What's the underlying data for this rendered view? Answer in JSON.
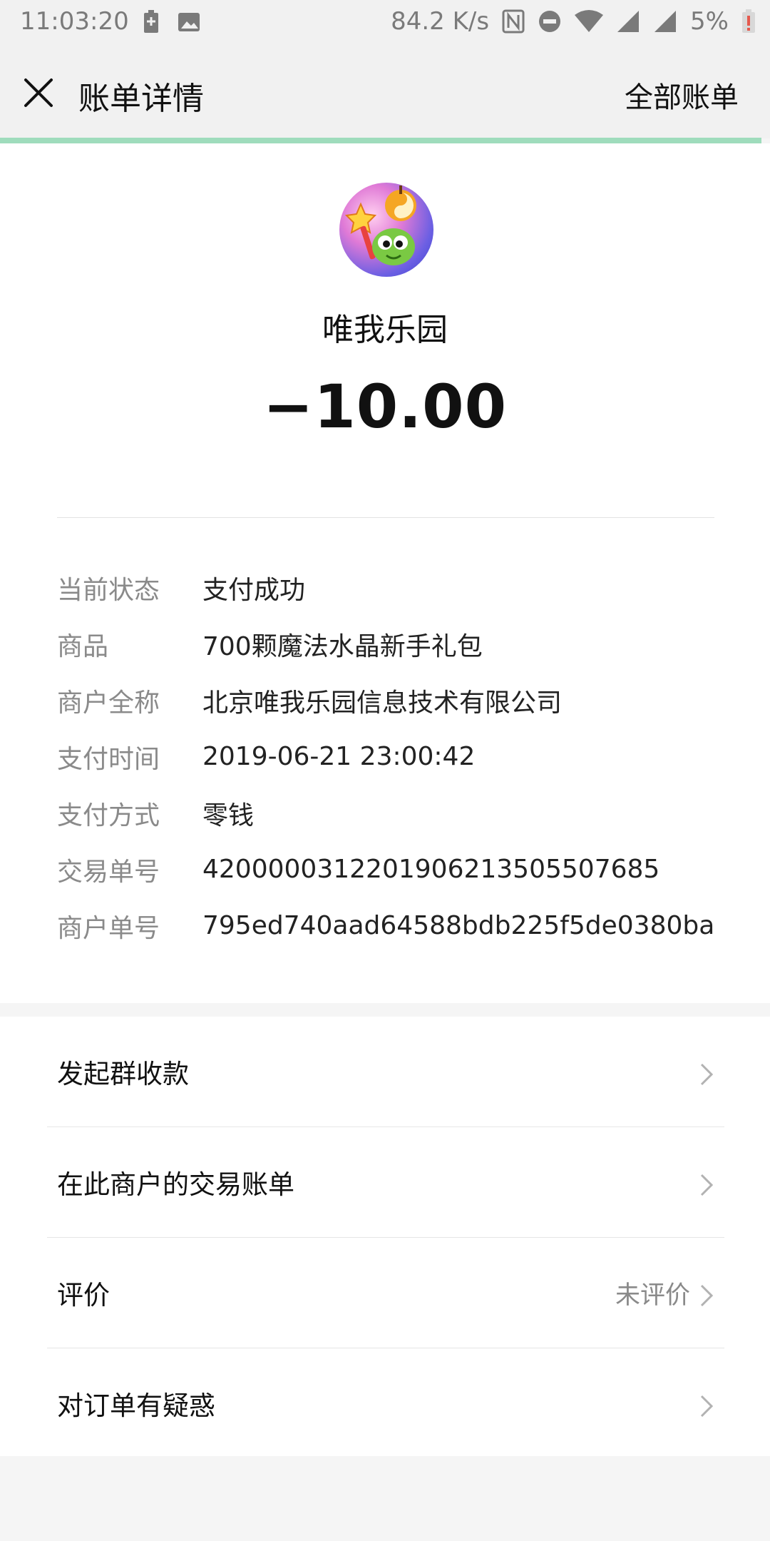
{
  "status_bar": {
    "time": "11:03:20",
    "net_speed": "84.2 K/s",
    "battery": "5%",
    "icons": [
      "battery-saver-icon",
      "image-icon",
      "nfc-icon",
      "dnd-icon",
      "wifi-icon",
      "signal-icon",
      "signal-icon",
      "battery-low-icon"
    ]
  },
  "header": {
    "title": "账单详情",
    "right_link": "全部账单"
  },
  "summary": {
    "merchant_name": "唯我乐园",
    "amount": "−10.00"
  },
  "details": [
    {
      "label": "当前状态",
      "value": "支付成功"
    },
    {
      "label": "商品",
      "value": "700颗魔法水晶新手礼包"
    },
    {
      "label": "商户全称",
      "value": "北京唯我乐园信息技术有限公司"
    },
    {
      "label": "支付时间",
      "value": "2019-06-21 23:00:42"
    },
    {
      "label": "支付方式",
      "value": "零钱"
    },
    {
      "label": "交易单号",
      "value": "4200000312201906213505507685"
    },
    {
      "label": "商户单号",
      "value": "795ed740aad64588bdb225f5de0380ba"
    }
  ],
  "actions": [
    {
      "label": "发起群收款",
      "sub": ""
    },
    {
      "label": "在此商户的交易账单",
      "sub": ""
    },
    {
      "label": "评价",
      "sub": "未评价"
    },
    {
      "label": "对订单有疑惑",
      "sub": ""
    }
  ],
  "colors": {
    "accent_line": "#9fdcbc",
    "background": "#f5f5f5",
    "label_gray": "#8a8a8a"
  }
}
